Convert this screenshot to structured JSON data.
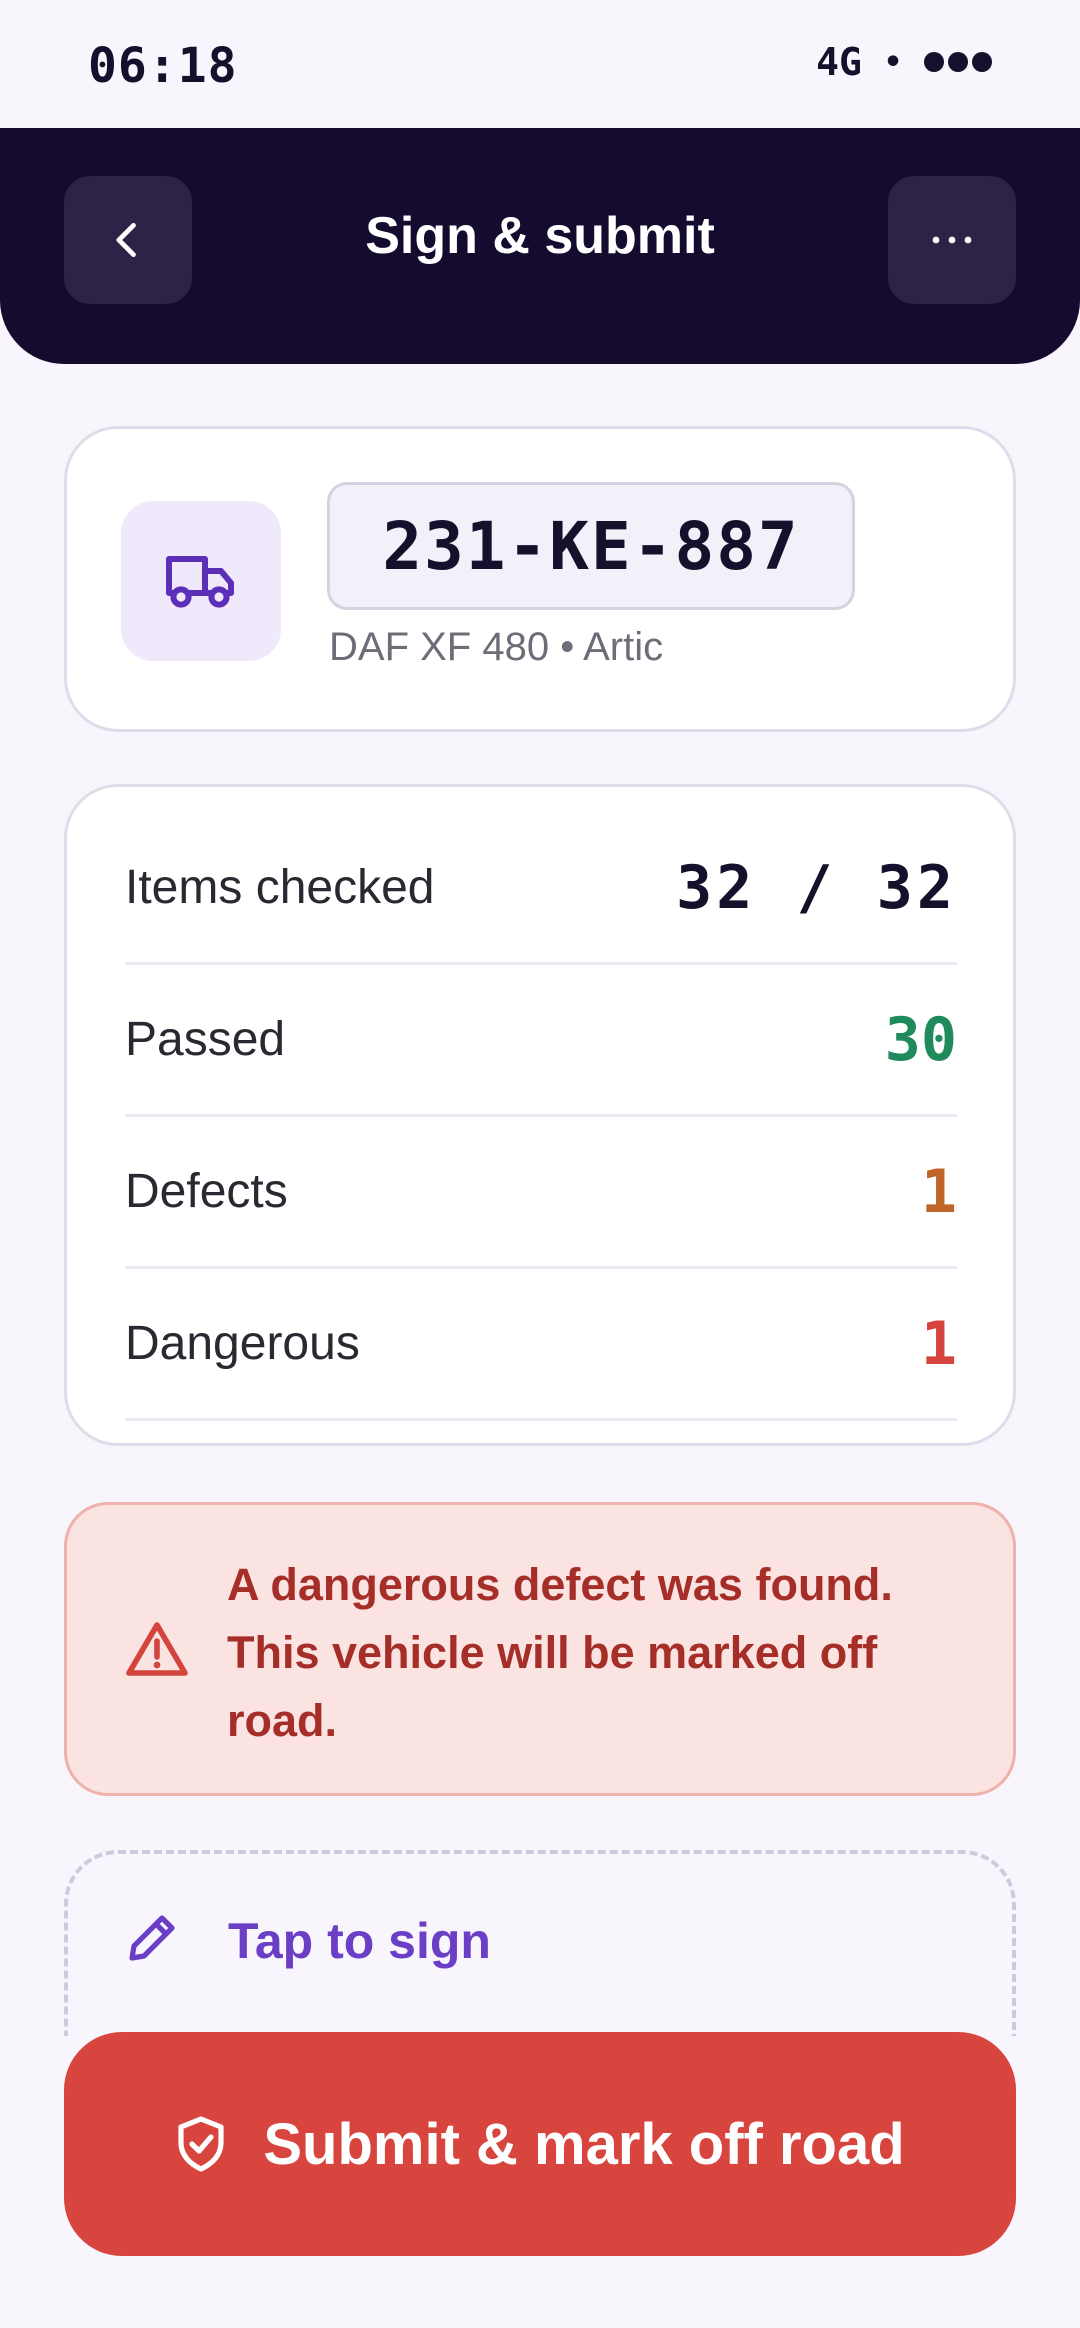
{
  "status_bar": {
    "time": "06:18",
    "network": "4G",
    "separator": "•"
  },
  "header": {
    "title": "Sign & submit",
    "back_icon": "chevron-left-icon",
    "more_icon": "ellipsis-icon"
  },
  "vehicle": {
    "icon": "truck-icon",
    "plate": "231-KE-887",
    "meta": "DAF XF 480 • Artic"
  },
  "summary": {
    "rows": [
      {
        "label": "Items checked",
        "value": "32 / 32"
      },
      {
        "label": "Passed",
        "value": "30"
      },
      {
        "label": "Defects",
        "value": "1"
      },
      {
        "label": "Dangerous",
        "value": "1"
      }
    ]
  },
  "alert": {
    "icon": "warning-triangle-icon",
    "message": "A dangerous defect was found. This vehicle will be marked off road."
  },
  "signature": {
    "icon": "pencil-icon",
    "label": "Tap to sign"
  },
  "submit": {
    "icon": "shield-check-icon",
    "label": "Submit & mark off road"
  },
  "colors": {
    "header_bg": "#150b2e",
    "accent": "#6a3fc6",
    "passed": "#1f8a5c",
    "defects": "#c0652a",
    "danger": "#d4443d"
  }
}
